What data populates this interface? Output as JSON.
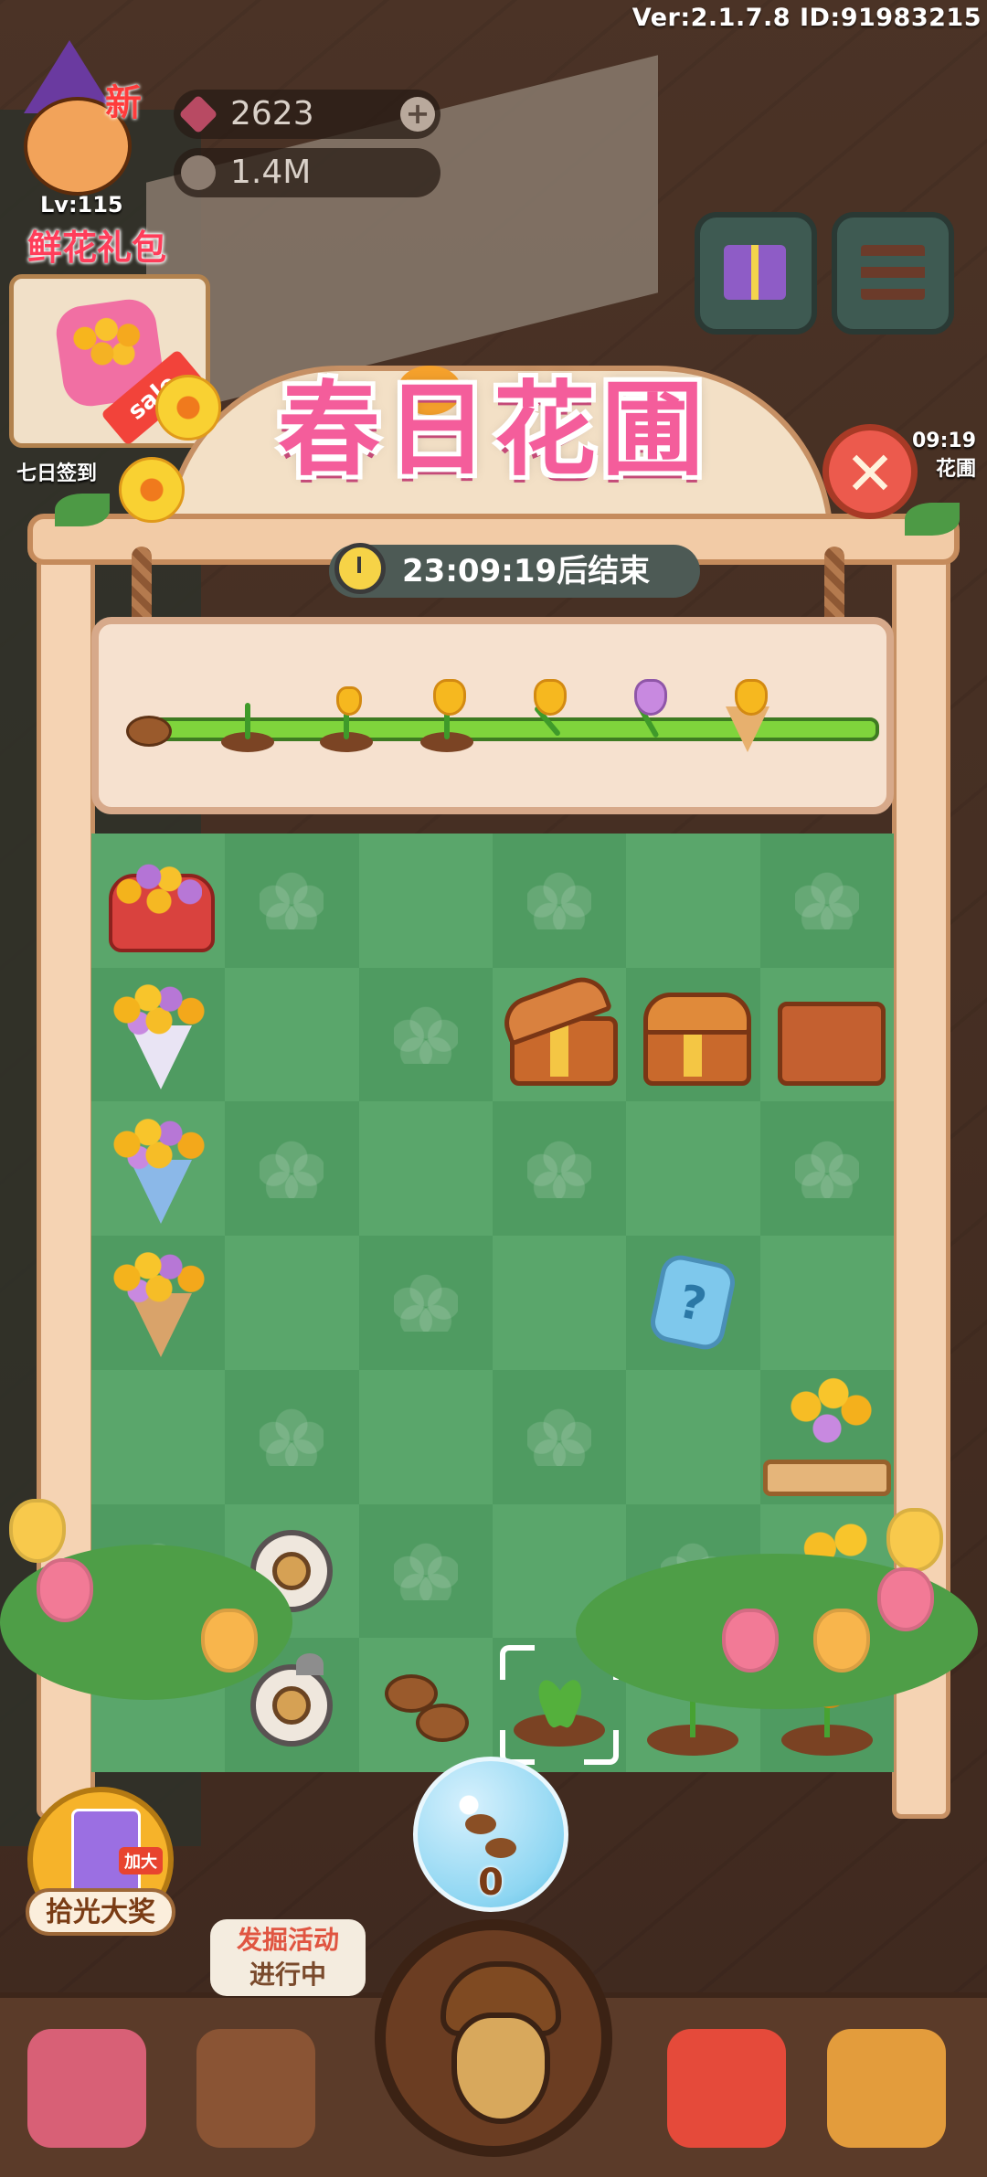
{
  "hud": {
    "version_text": "Ver:2.1.7.8 ID:91983215",
    "new_badge": "新",
    "level": "Lv:115",
    "gems": "2623",
    "coins": "1.4M",
    "gems_plus": "+"
  },
  "promo": {
    "title": "鲜花礼包",
    "sale_label": "sale",
    "seven_day_label": "七日签到"
  },
  "right_edge": {
    "timer_fragment": "09:19",
    "label_fragment": "花圃"
  },
  "event": {
    "title": "春日花圃",
    "countdown": "23:09:19后结束",
    "close_symbol": "✕"
  },
  "progress_stages": [
    "seed",
    "sprout",
    "bud",
    "tulip",
    "cut-tulips",
    "mixed-sprig",
    "bouquet"
  ],
  "grid": {
    "rows": 7,
    "cols": 6,
    "items": [
      [
        "heart-box-bouquet",
        "empty",
        "empty",
        "empty",
        "empty",
        "empty"
      ],
      [
        "bouquet-white",
        "empty",
        "empty",
        "chest-open",
        "chest-empty-lid",
        "chest-empty"
      ],
      [
        "bouquet-blue",
        "empty",
        "empty",
        "empty",
        "empty",
        "empty"
      ],
      [
        "bouquet-kraft",
        "empty",
        "empty",
        "empty",
        "mystery-box",
        "empty"
      ],
      [
        "empty",
        "empty",
        "empty",
        "empty",
        "empty",
        "planter-tulips"
      ],
      [
        "empty",
        "seed-coin",
        "empty",
        "empty",
        "empty",
        "tulip-sprig"
      ],
      [
        "empty",
        "seed-pocket-watch",
        "seeds",
        "sprout",
        "bud",
        "tulip-plant"
      ]
    ],
    "selected_cell": "6-3",
    "mystery_symbol": "?"
  },
  "seed_bubble": {
    "count": "0"
  },
  "grand_prize": {
    "label": "拾光大奖",
    "tag": "加大"
  },
  "dig_tip": {
    "line1": "发掘活动",
    "line2": "进行中"
  },
  "bottom_nav": [
    "shop-icon",
    "dig-event-icon",
    "acorn-button",
    "mystery-cube-icon",
    "home-icon"
  ]
}
